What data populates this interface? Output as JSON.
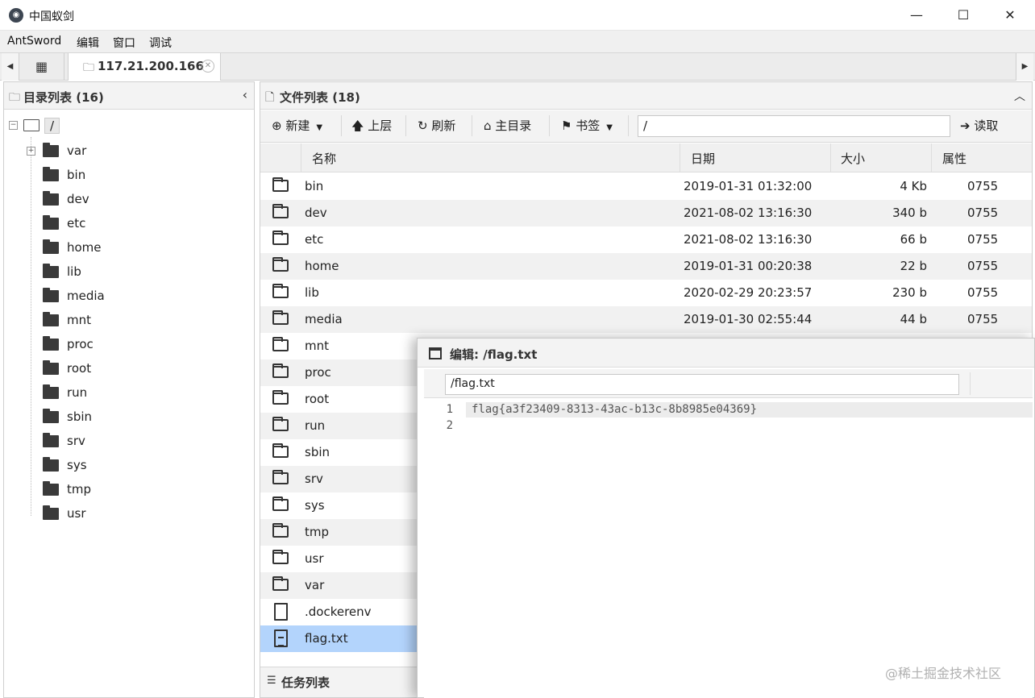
{
  "window": {
    "title": "中国蚁剑",
    "minimize": "—",
    "maximize": "☐",
    "close": "✕"
  },
  "menu": [
    "AntSword",
    "编辑",
    "窗口",
    "调试"
  ],
  "tabs": {
    "left_arrow": "◀",
    "right_arrow": "▶",
    "home_icon": "grid-icon",
    "host": "117.21.200.166"
  },
  "dir_panel": {
    "title": "目录列表 (16)",
    "root": "/",
    "items": [
      "var",
      "bin",
      "dev",
      "etc",
      "home",
      "lib",
      "media",
      "mnt",
      "proc",
      "root",
      "run",
      "sbin",
      "srv",
      "sys",
      "tmp",
      "usr"
    ]
  },
  "file_panel": {
    "title": "文件列表 (18)",
    "toolbar": {
      "new": "新建",
      "up": "上层",
      "refresh": "刷新",
      "home": "主目录",
      "bookmark": "书签",
      "path": "/",
      "read": "读取"
    },
    "columns": [
      "名称",
      "日期",
      "大小",
      "属性"
    ],
    "rows": [
      {
        "name": "bin",
        "date": "2019-01-31 01:32:00",
        "size": "4 Kb",
        "perm": "0755",
        "type": "folder"
      },
      {
        "name": "dev",
        "date": "2021-08-02 13:16:30",
        "size": "340 b",
        "perm": "0755",
        "type": "folder"
      },
      {
        "name": "etc",
        "date": "2021-08-02 13:16:30",
        "size": "66 b",
        "perm": "0755",
        "type": "folder"
      },
      {
        "name": "home",
        "date": "2019-01-31 00:20:38",
        "size": "22 b",
        "perm": "0755",
        "type": "folder"
      },
      {
        "name": "lib",
        "date": "2020-02-29 20:23:57",
        "size": "230 b",
        "perm": "0755",
        "type": "folder"
      },
      {
        "name": "media",
        "date": "2019-01-30 02:55:44",
        "size": "44 b",
        "perm": "0755",
        "type": "folder"
      },
      {
        "name": "mnt",
        "type": "folder"
      },
      {
        "name": "proc",
        "type": "folder"
      },
      {
        "name": "root",
        "type": "folder"
      },
      {
        "name": "run",
        "type": "folder"
      },
      {
        "name": "sbin",
        "type": "folder"
      },
      {
        "name": "srv",
        "type": "folder"
      },
      {
        "name": "sys",
        "type": "folder"
      },
      {
        "name": "tmp",
        "type": "folder"
      },
      {
        "name": "usr",
        "type": "folder"
      },
      {
        "name": "var",
        "type": "folder"
      },
      {
        "name": ".dockerenv",
        "type": "file"
      },
      {
        "name": "flag.txt",
        "type": "text-file",
        "selected": true
      }
    ],
    "task_bar": "任务列表"
  },
  "editor": {
    "title": "编辑: /flag.txt",
    "path": "/flag.txt",
    "lines": [
      "flag{a3f23409-8313-43ac-b13c-8b8985e04369}",
      ""
    ],
    "line_numbers": [
      "1",
      "2"
    ]
  },
  "watermark": "@稀土掘金技术社区",
  "colors": {
    "selected_row": "#b3d4fc",
    "alt_row": "#f1f1f1",
    "header_bg": "#f3f3f3"
  }
}
